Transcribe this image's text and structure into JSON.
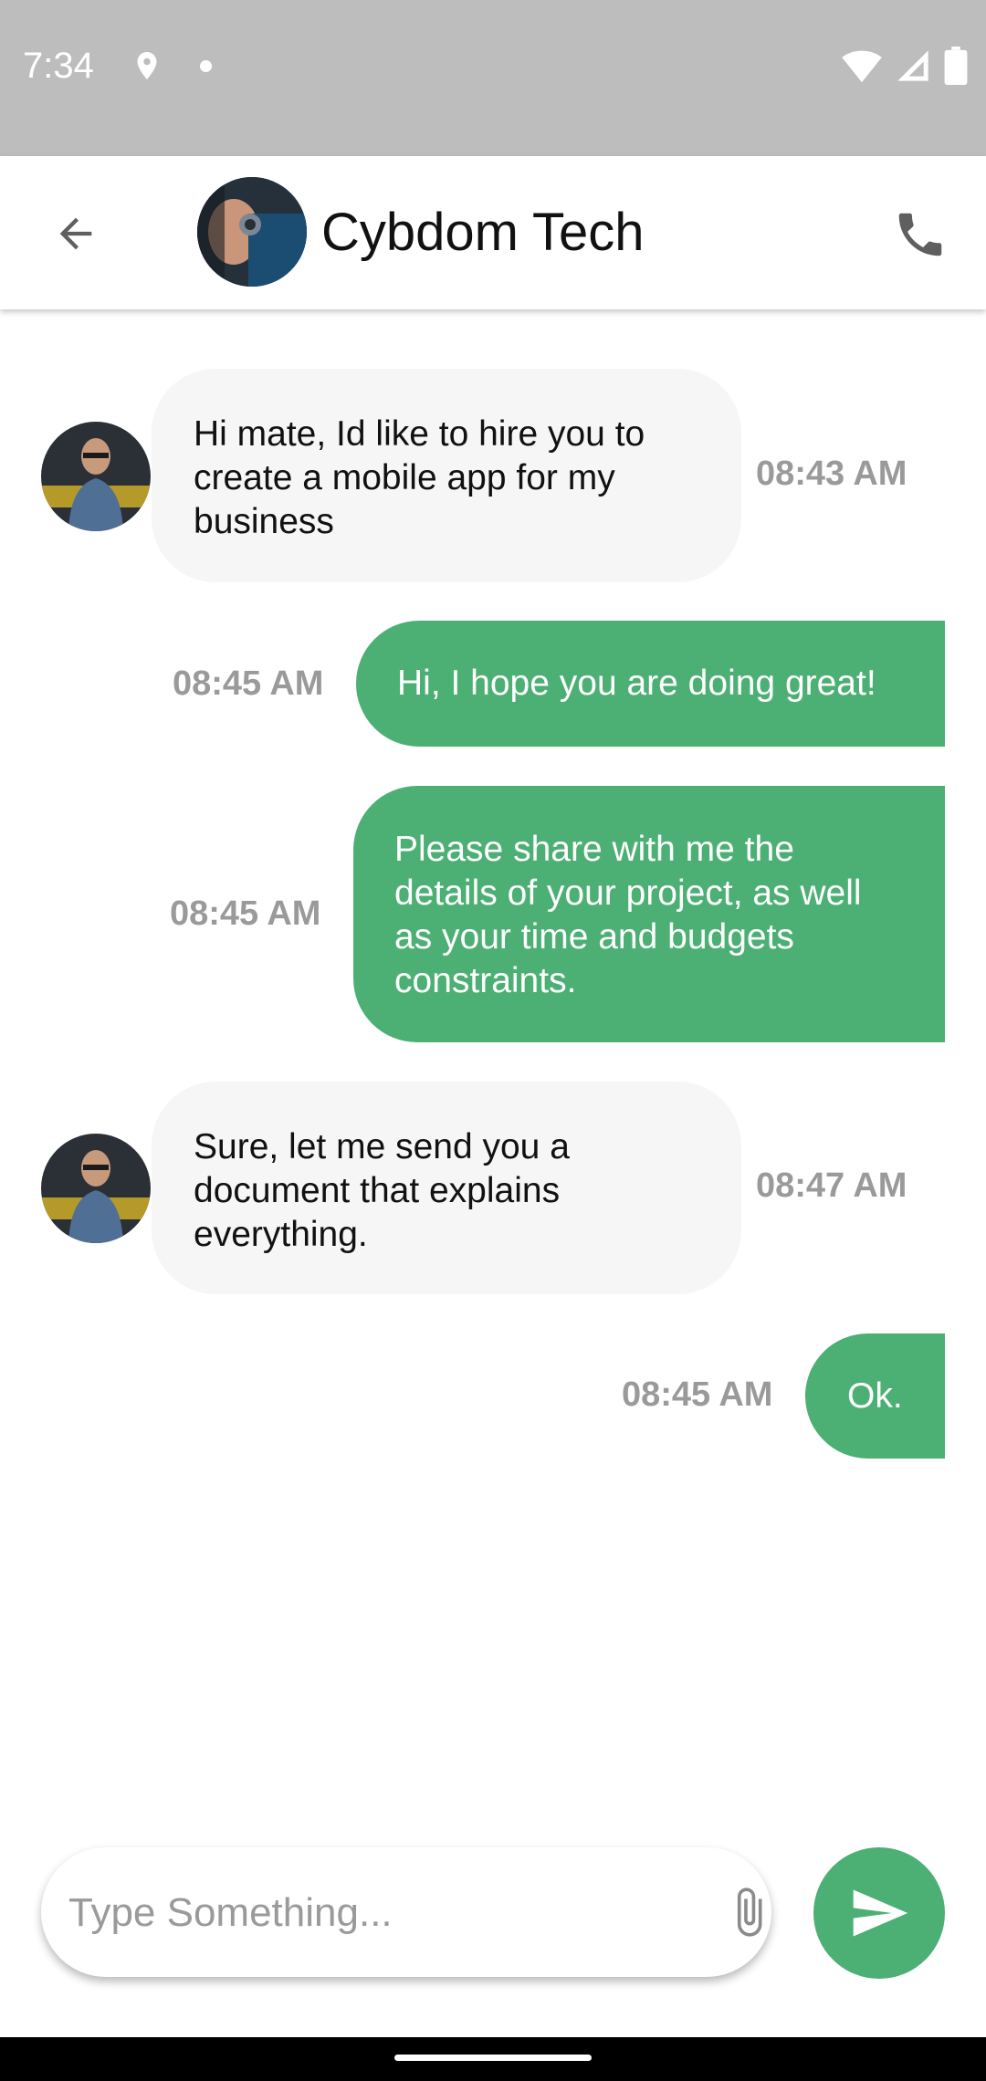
{
  "status_bar": {
    "time": "7:34"
  },
  "header": {
    "contact_name": "Cybdom Tech"
  },
  "messages": [
    {
      "direction": "incoming",
      "lines": [
        "Hi mate, Id like to hire you to",
        "create a mobile app for my",
        "business"
      ],
      "time": "08:43 AM"
    },
    {
      "direction": "outgoing",
      "lines": [
        "Hi, I hope you are doing great!"
      ],
      "time": "08:45 AM"
    },
    {
      "direction": "outgoing",
      "lines": [
        "Please share with me the",
        "details of your project, as well",
        "as your time and budgets",
        "constraints."
      ],
      "time": "08:45 AM"
    },
    {
      "direction": "incoming",
      "lines": [
        "Sure, let me send you a",
        "document that explains",
        "everything."
      ],
      "time": "08:47 AM"
    },
    {
      "direction": "outgoing",
      "lines": [
        "Ok."
      ],
      "time": "08:45 AM"
    }
  ],
  "composer": {
    "placeholder": "Type Something..."
  },
  "icons": {
    "back": "arrow-back-icon",
    "call": "phone-icon",
    "attach": "paperclip-icon",
    "send": "send-icon"
  },
  "colors": {
    "outgoing_bubble": "#4caf74",
    "incoming_bubble": "#f6f6f6",
    "timestamp": "#9a9a9a",
    "status_bar": "#bdbdbd"
  }
}
